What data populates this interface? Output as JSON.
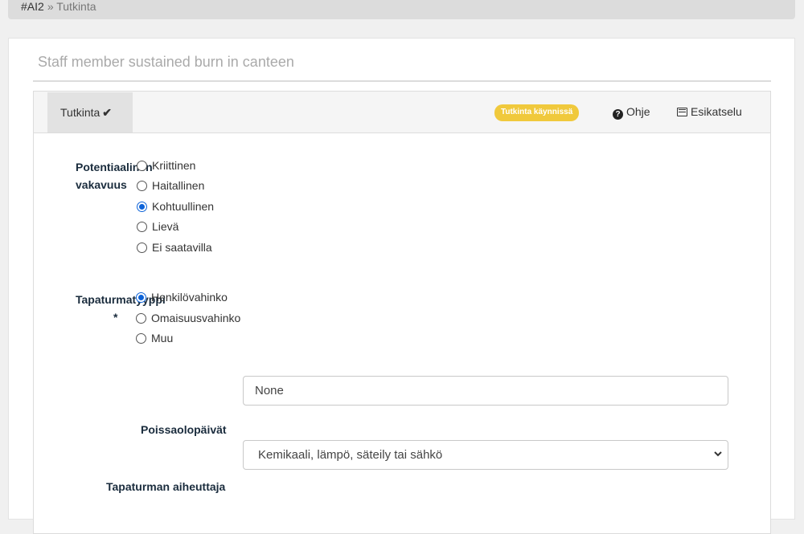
{
  "breadcrumb": {
    "id": "#AI2",
    "current": "» Tutkinta"
  },
  "page": {
    "title": "Staff member sustained burn in canteen"
  },
  "tabbar": {
    "tab": "Tutkinta",
    "tab_check": "✔",
    "status": "Tutkinta käynnissä",
    "status_color": "#f0c93c",
    "help": "Ohje",
    "preview": "Esikatselu"
  },
  "form": {
    "severity": {
      "label": "Potentiaalinen vakavuus",
      "options": [
        "Kriittinen",
        "Haitallinen",
        "Kohtuullinen",
        "Lievä",
        "Ei saatavilla"
      ],
      "selected": "Kohtuullinen"
    },
    "accident_type": {
      "label": "Tapaturmatyyppi",
      "required": "*",
      "options": [
        "Henkilövahinko",
        "Omaisuusvahinko",
        "Muu"
      ],
      "selected": "Henkilövahinko"
    },
    "absence_days": {
      "label": "Poissaolopäivät",
      "value": "None"
    },
    "cause": {
      "label": "Tapaturman aiheuttaja",
      "value": "Kemikaali, lämpö, säteily tai sähkö"
    }
  },
  "icons": {
    "help": "question-circle-icon",
    "preview": "list-icon",
    "select": "chevron-down-icon"
  }
}
